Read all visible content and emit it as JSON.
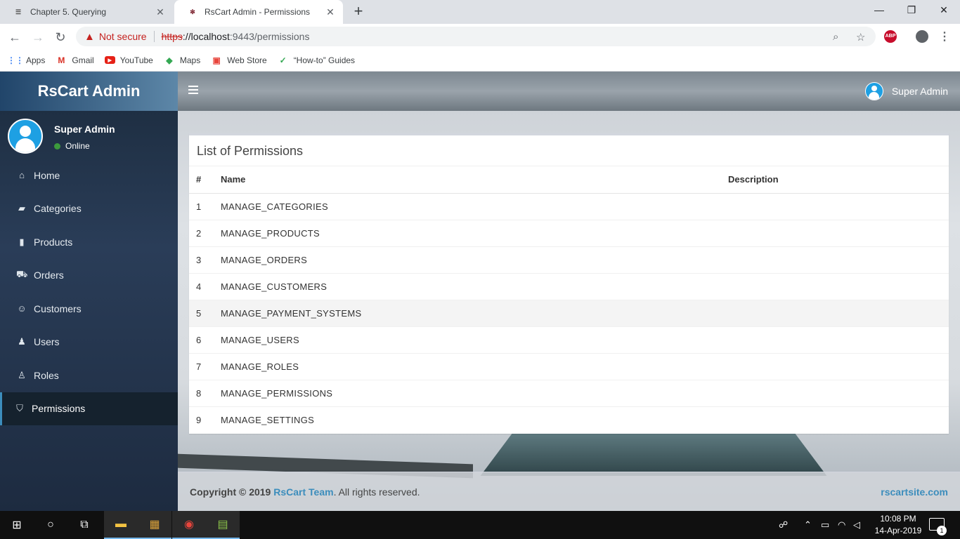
{
  "browser": {
    "tabs": [
      {
        "title": "Chapter 5. Querying",
        "favicon": "jboss-icon"
      },
      {
        "title": "RsCart Admin - Permissions",
        "favicon": "rscart-icon"
      }
    ],
    "address": {
      "warning": "Not secure",
      "scheme": "https",
      "host": "://localhost",
      "port_path": ":9443/permissions"
    },
    "bookmarks": [
      "Apps",
      "Gmail",
      "YouTube",
      "Maps",
      "Web Store",
      "“How-to” Guides"
    ],
    "abp_label": "ABP"
  },
  "app": {
    "brand": "RsCart Admin",
    "user": {
      "name": "Super Admin",
      "status": "Online"
    },
    "menu": [
      {
        "label": "Home",
        "icon": "home-icon"
      },
      {
        "label": "Categories",
        "icon": "folder-open-icon"
      },
      {
        "label": "Products",
        "icon": "file-icon"
      },
      {
        "label": "Orders",
        "icon": "cart-icon"
      },
      {
        "label": "Customers",
        "icon": "smile-icon"
      },
      {
        "label": "Users",
        "icon": "users-icon"
      },
      {
        "label": "Roles",
        "icon": "user-icon"
      },
      {
        "label": "Permissions",
        "icon": "shield-icon",
        "active": true
      }
    ],
    "topbar_user": "Super Admin",
    "box_title": "List of Permissions",
    "table": {
      "headers": [
        "#",
        "Name",
        "Description"
      ],
      "rows": [
        [
          "1",
          "MANAGE_CATEGORIES",
          ""
        ],
        [
          "2",
          "MANAGE_PRODUCTS",
          ""
        ],
        [
          "3",
          "MANAGE_ORDERS",
          ""
        ],
        [
          "4",
          "MANAGE_CUSTOMERS",
          ""
        ],
        [
          "5",
          "MANAGE_PAYMENT_SYSTEMS",
          ""
        ],
        [
          "6",
          "MANAGE_USERS",
          ""
        ],
        [
          "7",
          "MANAGE_ROLES",
          ""
        ],
        [
          "8",
          "MANAGE_PERMISSIONS",
          ""
        ],
        [
          "9",
          "MANAGE_SETTINGS",
          ""
        ]
      ]
    },
    "footer": {
      "copyright": "Copyright © 2019",
      "team": "RsCart Team",
      "rights": ". All rights reserved.",
      "site": "rscartsite.com"
    }
  },
  "taskbar": {
    "time": "10:08 PM",
    "date": "14-Apr-2019",
    "notification_count": "1"
  },
  "colors": {
    "accent": "#3c8dbc",
    "avatar": "#1ea0e3",
    "online": "#3c9a3c"
  }
}
